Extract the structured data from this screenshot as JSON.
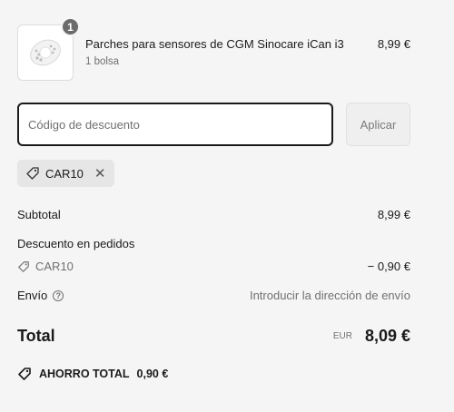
{
  "product": {
    "quantity": "1",
    "name": "Parches para sensores de CGM Sinocare iCan i3",
    "variant": "1 bolsa",
    "price": "8,99 €",
    "thumbnail_icon": "patch-product-image"
  },
  "discount": {
    "placeholder": "Código de descuento",
    "value": "",
    "apply_label": "Aplicar",
    "applied_code": "CAR10"
  },
  "summary": {
    "subtotal_label": "Subtotal",
    "subtotal_value": "8,99 €",
    "order_discount_label": "Descuento en pedidos",
    "discount_code": "CAR10",
    "discount_value": "− 0,90 €",
    "shipping_label": "Envío",
    "shipping_value": "Introducir la dirección de envío",
    "total_label": "Total",
    "currency": "EUR",
    "total_value": "8,09 €",
    "savings_label": "AHORRO TOTAL",
    "savings_value": "0,90 €"
  }
}
